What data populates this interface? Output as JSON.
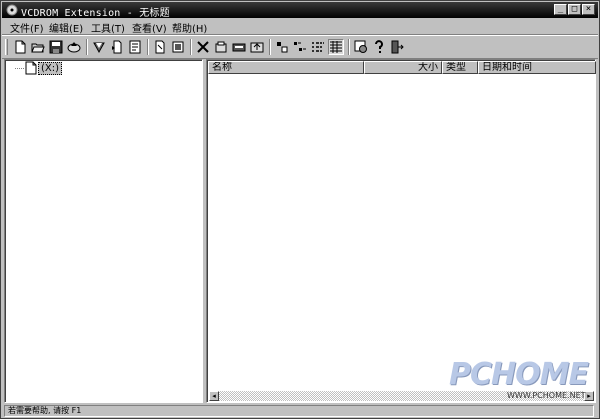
{
  "window": {
    "title": "VCDROM Extension - 无标题",
    "controls": {
      "minimize": "_",
      "maximize": "□",
      "close": "×"
    }
  },
  "menu": [
    "文件(F)",
    "编辑(E)",
    "工具(T)",
    "查看(V)",
    "帮助(H)"
  ],
  "toolbar": {
    "groups": [
      [
        "new-icon",
        "open-folder-icon",
        "save-icon",
        "eject-disc-icon"
      ],
      [
        "burn-icon",
        "add-file-icon",
        "properties-icon"
      ],
      [
        "copy-icon",
        "cut-file-icon"
      ],
      [
        "delete-icon",
        "new-folder-icon",
        "drive-icon",
        "up-folder-icon"
      ],
      [
        "large-icons-icon",
        "small-icons-icon",
        "list-view-icon",
        "details-view-icon"
      ],
      [
        "settings-icon",
        "help-icon",
        "exit-icon"
      ]
    ],
    "active": "details-view-icon"
  },
  "tree": {
    "root_label": "(X:)"
  },
  "list": {
    "columns": [
      "名称",
      "大小",
      "类型",
      "日期和时间"
    ]
  },
  "scroll": {
    "left_arrow": "◂",
    "right_arrow": "▸"
  },
  "statusbar": {
    "text": "若需要帮助, 请按 F1"
  },
  "watermark": {
    "brand": "PCHOME",
    "url": "WWW.PCHOME.NET"
  },
  "colors": {
    "face": "#c0c0c0",
    "title": "#000000",
    "watermark": "#b8c8e6"
  }
}
